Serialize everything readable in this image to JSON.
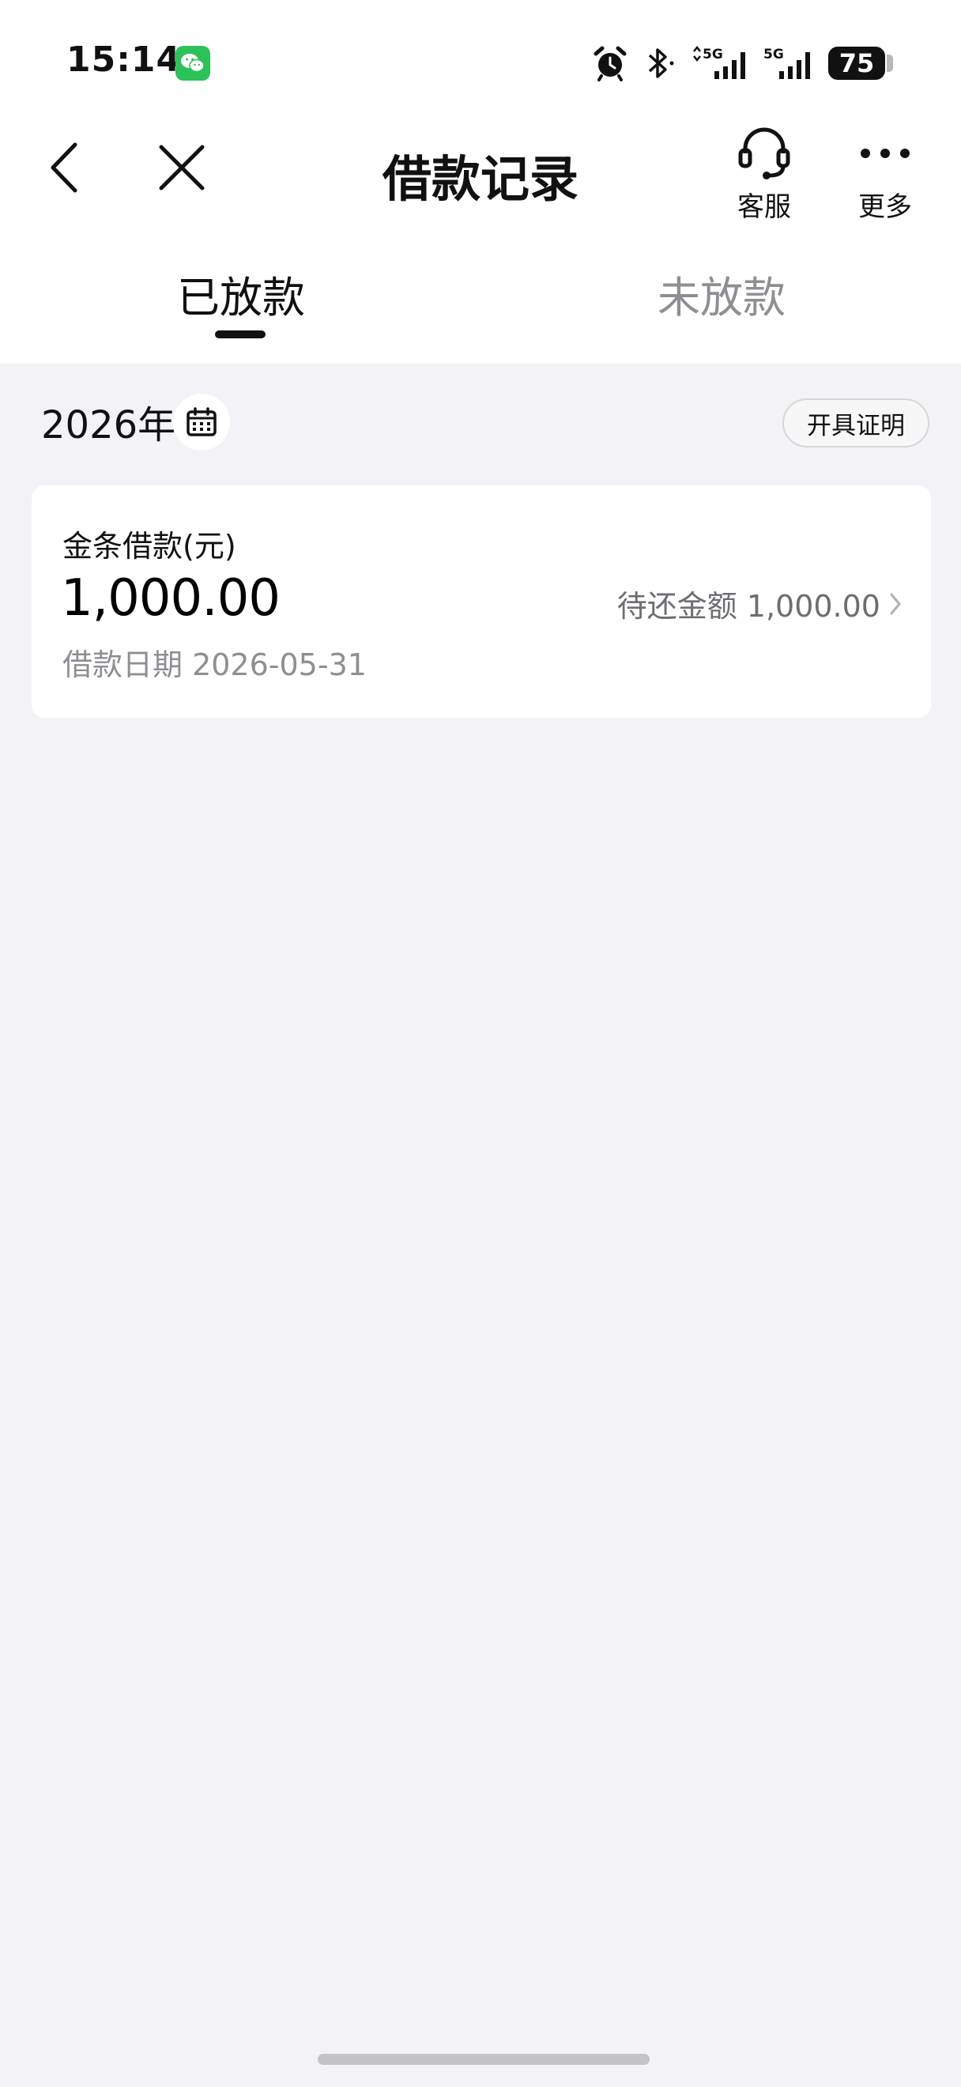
{
  "status_bar": {
    "time": "15:14",
    "network_1": "5G",
    "network_2": "5G",
    "battery_level": "75",
    "icons": [
      "wechat-icon",
      "alarm-icon",
      "bluetooth-icon",
      "signal-icon",
      "signal-icon",
      "battery-icon"
    ]
  },
  "nav": {
    "title": "借款记录",
    "service_label": "客服",
    "more_label": "更多",
    "icons": [
      "back-arrow-icon",
      "close-icon",
      "headset-icon",
      "more-dots-icon"
    ]
  },
  "tabs": [
    {
      "label": "已放款",
      "active": true
    },
    {
      "label": "未放款",
      "active": false
    }
  ],
  "filter": {
    "year": "2026年",
    "certificate_label": "开具证明",
    "icons": [
      "calendar-icon"
    ]
  },
  "loans": [
    {
      "product": "金条借款(元)",
      "amount": "1,000.00",
      "date_text": "借款日期 2026-05-31",
      "remaining_text": "待还金额 1,000.00"
    }
  ],
  "colors": {
    "page_background": "#f2f2f7",
    "card_background": "#ffffff",
    "primary_text": "#111111",
    "secondary_text": "#8e8e93",
    "wechat_green": "#2dc15a"
  }
}
